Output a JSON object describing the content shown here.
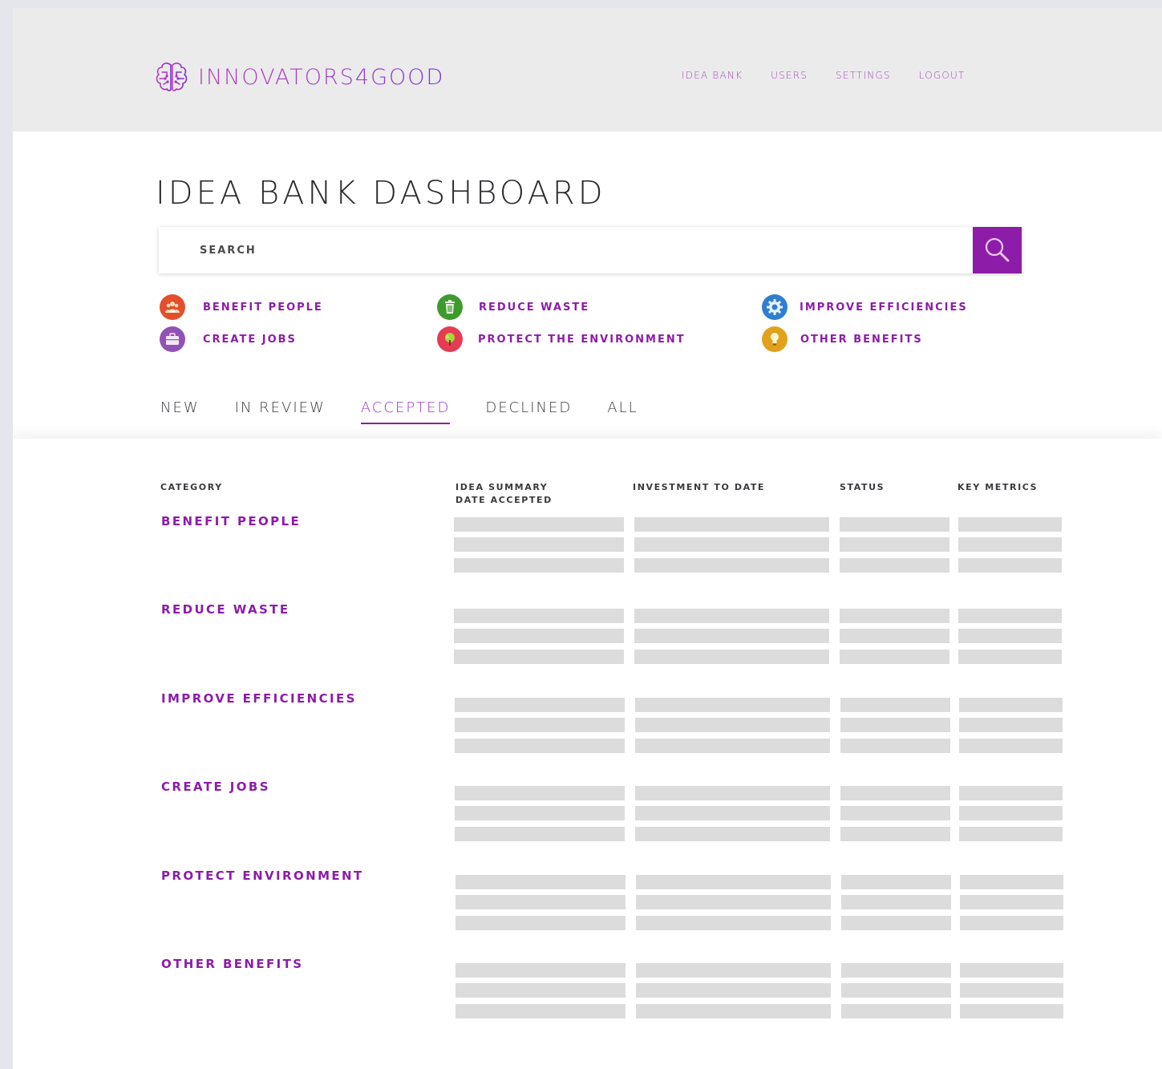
{
  "brand": {
    "name": "INNOVATORS4GOOD",
    "icon": "brain-icon"
  },
  "nav": {
    "items": [
      {
        "label": "IDEA BANK"
      },
      {
        "label": "USERS"
      },
      {
        "label": "SETTINGS"
      },
      {
        "label": "LOGOUT"
      }
    ]
  },
  "page": {
    "title": "IDEA BANK DASHBOARD"
  },
  "search": {
    "placeholder": "SEARCH",
    "value": "",
    "button_icon": "search-icon"
  },
  "legend": {
    "benefit_people": {
      "label": "BENEFIT PEOPLE",
      "icon": "people-icon",
      "color": "#e24f2d"
    },
    "create_jobs": {
      "label": "CREATE JOBS",
      "icon": "briefcase-icon",
      "color": "#9152b5"
    },
    "reduce_waste": {
      "label": "REDUCE WASTE",
      "icon": "trash-icon",
      "color": "#3f9a2e"
    },
    "protect_environment": {
      "label": "PROTECT THE ENVIRONMENT",
      "icon": "tree-icon",
      "color": "#e63b54"
    },
    "improve_efficiencies": {
      "label": "IMPROVE EFFICIENCIES",
      "icon": "gear-icon",
      "color": "#2f7fd1"
    },
    "other_benefits": {
      "label": "OTHER BENEFITS",
      "icon": "lightbulb-icon",
      "color": "#e0a21c"
    }
  },
  "tabs": {
    "items": [
      {
        "label": "NEW"
      },
      {
        "label": "IN REVIEW"
      },
      {
        "label": "ACCEPTED"
      },
      {
        "label": "DECLINED"
      },
      {
        "label": "ALL"
      }
    ],
    "active": "ACCEPTED"
  },
  "table": {
    "headers": {
      "category": "CATEGORY",
      "idea_summary_line1": "IDEA SUMMARY",
      "idea_summary_line2": "DATE ACCEPTED",
      "investment": "INVESTMENT TO DATE",
      "status": "STATUS",
      "key_metrics": "KEY METRICS"
    },
    "categories": [
      {
        "label": "BENEFIT PEOPLE"
      },
      {
        "label": "REDUCE WASTE"
      },
      {
        "label": "IMPROVE EFFICIENCIES"
      },
      {
        "label": "CREATE JOBS"
      },
      {
        "label": "PROTECT ENVIRONMENT"
      },
      {
        "label": "OTHER BENEFITS"
      }
    ]
  },
  "colors": {
    "accent": "#8d1ca9",
    "header_bg": "#ebebec",
    "placeholder_bar": "#dcdcdc"
  }
}
